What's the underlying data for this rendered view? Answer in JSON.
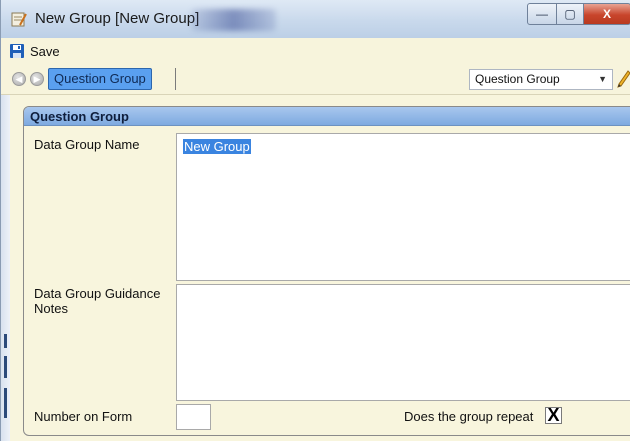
{
  "window": {
    "title": "New Group [New Group]",
    "controls": {
      "minimize": "—",
      "maximize": "▢",
      "close": "X"
    }
  },
  "toolbar": {
    "save_label": "Save"
  },
  "nav": {
    "breadcrumb": "Question Group",
    "view_select": "Question Group"
  },
  "panel": {
    "title": "Question Group",
    "fields": {
      "name_label": "Data Group Name",
      "name_value": "New Group",
      "notes_label": "Data Group Guidance Notes",
      "notes_value": "",
      "number_label": "Number on Form",
      "number_value": "",
      "repeat_label": "Does the group repeat",
      "repeat_checked_glyph": "X"
    }
  },
  "colors": {
    "form_background": "#f8f5dd",
    "panel_header": "#7eaae0",
    "selection": "#3a84e0",
    "breadcrumb_highlight": "#5aa0f0"
  }
}
